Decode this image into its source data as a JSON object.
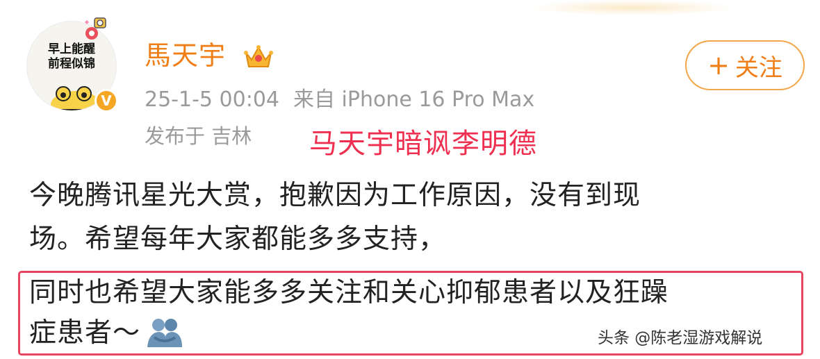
{
  "user": {
    "name": "馬天宇",
    "avatar_text_line1": "早上能醒",
    "avatar_text_line2": "前程似锦",
    "verified_badge": "V",
    "badge_icon": "crown-icon"
  },
  "post_meta": {
    "time": "25-1-5 00:04",
    "source": "来自 iPhone 16 Pro Max",
    "location": "发布于 吉林"
  },
  "follow_button": {
    "plus": "+",
    "label": "关注"
  },
  "annotation": "马天宇暗讽李明德",
  "post": {
    "line1": "今晚腾讯星光大赏，抱歉因为工作原因，没有到现",
    "line2": "场。希望每年大家都能多多支持，",
    "highlight_line1": "同时也希望大家能多多关注和关心抑郁患者以及狂躁",
    "highlight_line2": "症患者～",
    "emoji": "hug-icon"
  },
  "watermark": "头条 @陈老湿游戏解说",
  "colors": {
    "username": "#f07e16",
    "follow_border": "#f4a64a",
    "annotation": "#ef2f4f",
    "highlight_border": "#e7445f",
    "meta": "#9a9a9a"
  }
}
